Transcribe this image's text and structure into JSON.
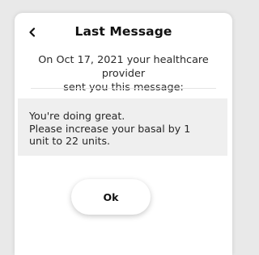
{
  "header": {
    "title": "Last Message",
    "back_icon": "chevron-left-icon"
  },
  "intro": {
    "line1": "On Oct 17, 2021 your healthcare provider",
    "line2": "sent you this message:"
  },
  "message": {
    "lines": [
      "You're doing great.",
      "Please increase your basal by 1",
      "unit to 22 units."
    ]
  },
  "actions": {
    "ok_label": "Ok"
  },
  "colors": {
    "background": "#e9e9e9",
    "card": "#ffffff",
    "message_box": "#efefef",
    "text": "#111111"
  }
}
